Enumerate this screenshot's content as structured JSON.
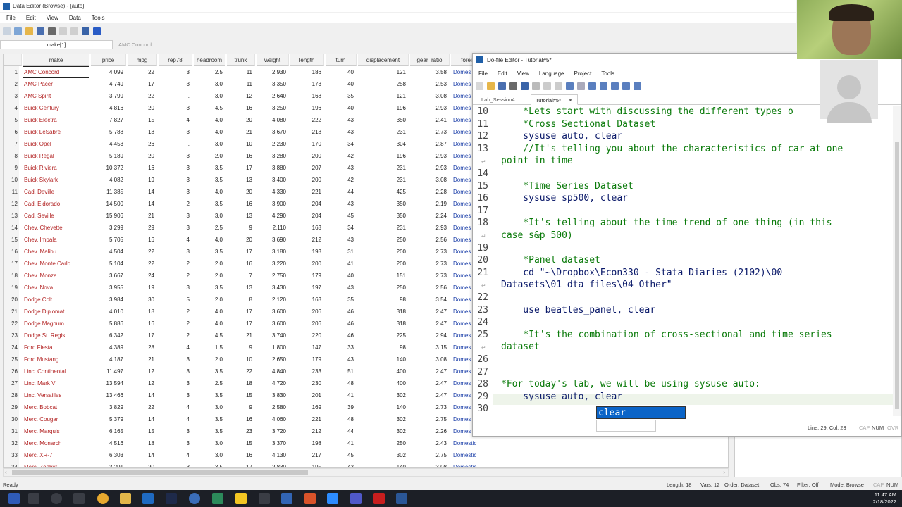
{
  "data_editor": {
    "title": "Data Editor (Browse) - [auto]",
    "menu": [
      "File",
      "Edit",
      "View",
      "Data",
      "Tools"
    ],
    "varname_box": "make[1]",
    "cell_value": "AMC Concord",
    "columns": [
      "make",
      "price",
      "mpg",
      "rep78",
      "headroom",
      "trunk",
      "weight",
      "length",
      "turn",
      "displacement",
      "gear_ratio",
      "forei"
    ],
    "rows": [
      [
        "1",
        "AMC Concord",
        "4,099",
        "22",
        "3",
        "2.5",
        "11",
        "2,930",
        "186",
        "40",
        "121",
        "3.58",
        "Domes"
      ],
      [
        "2",
        "AMC Pacer",
        "4,749",
        "17",
        "3",
        "3.0",
        "11",
        "3,350",
        "173",
        "40",
        "258",
        "2.53",
        "Domes"
      ],
      [
        "3",
        "AMC Spirit",
        "3,799",
        "22",
        ".",
        "3.0",
        "12",
        "2,640",
        "168",
        "35",
        "121",
        "3.08",
        "Domes"
      ],
      [
        "4",
        "Buick Century",
        "4,816",
        "20",
        "3",
        "4.5",
        "16",
        "3,250",
        "196",
        "40",
        "196",
        "2.93",
        "Domes"
      ],
      [
        "5",
        "Buick Electra",
        "7,827",
        "15",
        "4",
        "4.0",
        "20",
        "4,080",
        "222",
        "43",
        "350",
        "2.41",
        "Domes"
      ],
      [
        "6",
        "Buick LeSabre",
        "5,788",
        "18",
        "3",
        "4.0",
        "21",
        "3,670",
        "218",
        "43",
        "231",
        "2.73",
        "Domes"
      ],
      [
        "7",
        "Buick Opel",
        "4,453",
        "26",
        ".",
        "3.0",
        "10",
        "2,230",
        "170",
        "34",
        "304",
        "2.87",
        "Domes"
      ],
      [
        "8",
        "Buick Regal",
        "5,189",
        "20",
        "3",
        "2.0",
        "16",
        "3,280",
        "200",
        "42",
        "196",
        "2.93",
        "Domes"
      ],
      [
        "9",
        "Buick Riviera",
        "10,372",
        "16",
        "3",
        "3.5",
        "17",
        "3,880",
        "207",
        "43",
        "231",
        "2.93",
        "Domes"
      ],
      [
        "10",
        "Buick Skylark",
        "4,082",
        "19",
        "3",
        "3.5",
        "13",
        "3,400",
        "200",
        "42",
        "231",
        "3.08",
        "Domes"
      ],
      [
        "11",
        "Cad. Deville",
        "11,385",
        "14",
        "3",
        "4.0",
        "20",
        "4,330",
        "221",
        "44",
        "425",
        "2.28",
        "Domes"
      ],
      [
        "12",
        "Cad. Eldorado",
        "14,500",
        "14",
        "2",
        "3.5",
        "16",
        "3,900",
        "204",
        "43",
        "350",
        "2.19",
        "Domes"
      ],
      [
        "13",
        "Cad. Seville",
        "15,906",
        "21",
        "3",
        "3.0",
        "13",
        "4,290",
        "204",
        "45",
        "350",
        "2.24",
        "Domes"
      ],
      [
        "14",
        "Chev. Chevette",
        "3,299",
        "29",
        "3",
        "2.5",
        "9",
        "2,110",
        "163",
        "34",
        "231",
        "2.93",
        "Domes"
      ],
      [
        "15",
        "Chev. Impala",
        "5,705",
        "16",
        "4",
        "4.0",
        "20",
        "3,690",
        "212",
        "43",
        "250",
        "2.56",
        "Domes"
      ],
      [
        "16",
        "Chev. Malibu",
        "4,504",
        "22",
        "3",
        "3.5",
        "17",
        "3,180",
        "193",
        "31",
        "200",
        "2.73",
        "Domes"
      ],
      [
        "17",
        "Chev. Monte Carlo",
        "5,104",
        "22",
        "2",
        "2.0",
        "16",
        "3,220",
        "200",
        "41",
        "200",
        "2.73",
        "Domes"
      ],
      [
        "18",
        "Chev. Monza",
        "3,667",
        "24",
        "2",
        "2.0",
        "7",
        "2,750",
        "179",
        "40",
        "151",
        "2.73",
        "Domes"
      ],
      [
        "19",
        "Chev. Nova",
        "3,955",
        "19",
        "3",
        "3.5",
        "13",
        "3,430",
        "197",
        "43",
        "250",
        "2.56",
        "Domes"
      ],
      [
        "20",
        "Dodge Colt",
        "3,984",
        "30",
        "5",
        "2.0",
        "8",
        "2,120",
        "163",
        "35",
        "98",
        "3.54",
        "Domes"
      ],
      [
        "21",
        "Dodge Diplomat",
        "4,010",
        "18",
        "2",
        "4.0",
        "17",
        "3,600",
        "206",
        "46",
        "318",
        "2.47",
        "Domes"
      ],
      [
        "22",
        "Dodge Magnum",
        "5,886",
        "16",
        "2",
        "4.0",
        "17",
        "3,600",
        "206",
        "46",
        "318",
        "2.47",
        "Domes"
      ],
      [
        "23",
        "Dodge St. Regis",
        "6,342",
        "17",
        "2",
        "4.5",
        "21",
        "3,740",
        "220",
        "46",
        "225",
        "2.94",
        "Domes"
      ],
      [
        "24",
        "Ford Fiesta",
        "4,389",
        "28",
        "4",
        "1.5",
        "9",
        "1,800",
        "147",
        "33",
        "98",
        "3.15",
        "Domes"
      ],
      [
        "25",
        "Ford Mustang",
        "4,187",
        "21",
        "3",
        "2.0",
        "10",
        "2,650",
        "179",
        "43",
        "140",
        "3.08",
        "Domes"
      ],
      [
        "26",
        "Linc. Continental",
        "11,497",
        "12",
        "3",
        "3.5",
        "22",
        "4,840",
        "233",
        "51",
        "400",
        "2.47",
        "Domes"
      ],
      [
        "27",
        "Linc. Mark V",
        "13,594",
        "12",
        "3",
        "2.5",
        "18",
        "4,720",
        "230",
        "48",
        "400",
        "2.47",
        "Domes"
      ],
      [
        "28",
        "Linc. Versailles",
        "13,466",
        "14",
        "3",
        "3.5",
        "15",
        "3,830",
        "201",
        "41",
        "302",
        "2.47",
        "Domes"
      ],
      [
        "29",
        "Merc. Bobcat",
        "3,829",
        "22",
        "4",
        "3.0",
        "9",
        "2,580",
        "169",
        "39",
        "140",
        "2.73",
        "Domes"
      ],
      [
        "30",
        "Merc. Cougar",
        "5,379",
        "14",
        "4",
        "3.5",
        "16",
        "4,060",
        "221",
        "48",
        "302",
        "2.75",
        "Domes"
      ],
      [
        "31",
        "Merc. Marquis",
        "6,165",
        "15",
        "3",
        "3.5",
        "23",
        "3,720",
        "212",
        "44",
        "302",
        "2.26",
        "Domes"
      ],
      [
        "32",
        "Merc. Monarch",
        "4,516",
        "18",
        "3",
        "3.0",
        "15",
        "3,370",
        "198",
        "41",
        "250",
        "2.43",
        "Domestic"
      ],
      [
        "33",
        "Merc. XR-7",
        "6,303",
        "14",
        "4",
        "3.0",
        "16",
        "4,130",
        "217",
        "45",
        "302",
        "2.75",
        "Domestic"
      ],
      [
        "34",
        "Merc. Zephyr",
        "3,291",
        "20",
        "3",
        "3.5",
        "17",
        "2,830",
        "195",
        "43",
        "140",
        "3.08",
        "Domestic"
      ]
    ],
    "status": {
      "ready": "Ready",
      "length": "Length: 18",
      "vars": "Vars: 12",
      "order": "Order: Dataset",
      "obs": "Obs: 74",
      "filter": "Filter: Off",
      "mode": "Mode: Browse",
      "cap": "CAP",
      "num": "NUM"
    }
  },
  "dofile": {
    "title": "Do-file Editor - Tutorial#5*",
    "menu": [
      "File",
      "Edit",
      "View",
      "Language",
      "Project",
      "Tools"
    ],
    "tabs": [
      "Lab_Session4",
      "Tutorial#5*"
    ],
    "lines": [
      {
        "n": "10",
        "text": "    *Lets start with discussing the different types o",
        "kind": "comment"
      },
      {
        "n": "11",
        "text": "    *Cross Sectional Dataset",
        "kind": "comment"
      },
      {
        "n": "12",
        "text": "    sysuse auto, clear",
        "kind": "plain"
      },
      {
        "n": "13",
        "text": "    //It's telling you about the characteristics of car at one",
        "kind": "comment"
      },
      {
        "n": "",
        "text": "point in time",
        "kind": "comment",
        "wrap": true
      },
      {
        "n": "14",
        "text": "",
        "kind": "plain"
      },
      {
        "n": "15",
        "text": "    *Time Series Dataset",
        "kind": "comment"
      },
      {
        "n": "16",
        "text": "    sysuse sp500, clear",
        "kind": "plain"
      },
      {
        "n": "17",
        "text": "",
        "kind": "plain"
      },
      {
        "n": "18",
        "text": "    *It's telling about the time trend of one thing (in this",
        "kind": "comment"
      },
      {
        "n": "",
        "text": "case s&p 500)",
        "kind": "comment",
        "wrap": true
      },
      {
        "n": "19",
        "text": "",
        "kind": "plain"
      },
      {
        "n": "20",
        "text": "    *Panel dataset",
        "kind": "comment"
      },
      {
        "n": "21",
        "text": "    cd \"~\\Dropbox\\Econ330 - Stata Diaries (2102)\\00",
        "kind": "plain"
      },
      {
        "n": "",
        "text": "Datasets\\01 dta files\\04 Other\"",
        "kind": "str",
        "wrap": true
      },
      {
        "n": "22",
        "text": "",
        "kind": "plain"
      },
      {
        "n": "23",
        "text": "    use beatles_panel, clear",
        "kind": "plain"
      },
      {
        "n": "24",
        "text": "",
        "kind": "plain"
      },
      {
        "n": "25",
        "text": "    *It's the combination of cross-sectional and time series",
        "kind": "comment"
      },
      {
        "n": "",
        "text": "dataset",
        "kind": "comment",
        "wrap": true
      },
      {
        "n": "26",
        "text": "",
        "kind": "plain"
      },
      {
        "n": "27",
        "text": "",
        "kind": "plain"
      },
      {
        "n": "28",
        "text": "*For today's lab, we will be using sysuse auto:",
        "kind": "comment"
      },
      {
        "n": "29",
        "text": "    sysuse auto, clear",
        "kind": "plain"
      },
      {
        "n": "30",
        "text": "",
        "kind": "plain"
      }
    ],
    "autocomplete": "clear",
    "status": {
      "pos": "Line: 29, Col: 23",
      "cap": "CAP",
      "num": "NUM",
      "ovr": "OVR"
    }
  },
  "taskbar": {
    "time": "11:47 AM",
    "date": "2/18/2022"
  },
  "colors": {
    "make_text": "#b22222",
    "comment": "#0a7a0a",
    "code": "#0b1a6a",
    "selection": "#0a64c8"
  }
}
